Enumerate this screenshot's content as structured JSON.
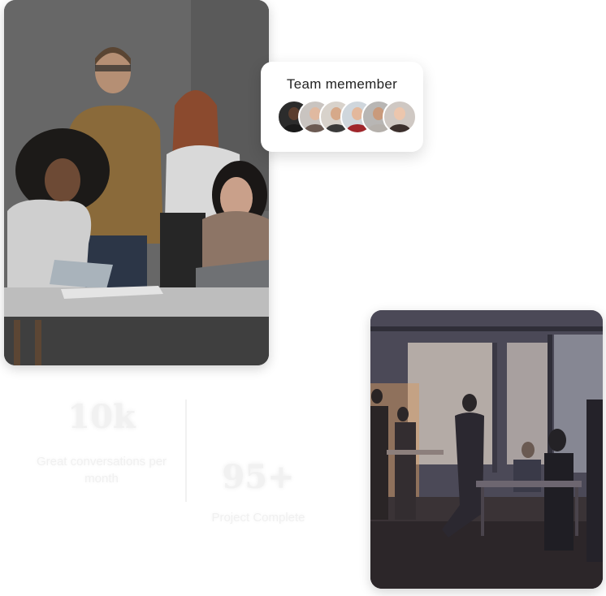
{
  "team_card": {
    "title": "Team memember",
    "avatars": [
      {
        "name": "avatar-1",
        "bg": "#2c2c2c",
        "skin": "#5a3d2e",
        "shirt": "#1a1a1a"
      },
      {
        "name": "avatar-2",
        "bg": "#c9c4c0",
        "skin": "#e0b9a0",
        "shirt": "#6b5a52"
      },
      {
        "name": "avatar-3",
        "bg": "#d8d2cb",
        "skin": "#d6a98a",
        "shirt": "#3a3a3a"
      },
      {
        "name": "avatar-4",
        "bg": "#cfd6dc",
        "skin": "#e3b89c",
        "shirt": "#a0262b"
      },
      {
        "name": "avatar-5",
        "bg": "#b8b6b4",
        "skin": "#c99a7c",
        "shirt": "#b5b0ab"
      },
      {
        "name": "avatar-6",
        "bg": "#cfc8c3",
        "skin": "#ecc6ad",
        "shirt": "#3b2f2c"
      }
    ]
  },
  "stats": [
    {
      "value": "10k",
      "label": "Great conversations per month"
    },
    {
      "value": "95+",
      "label": "Project Complete"
    }
  ]
}
